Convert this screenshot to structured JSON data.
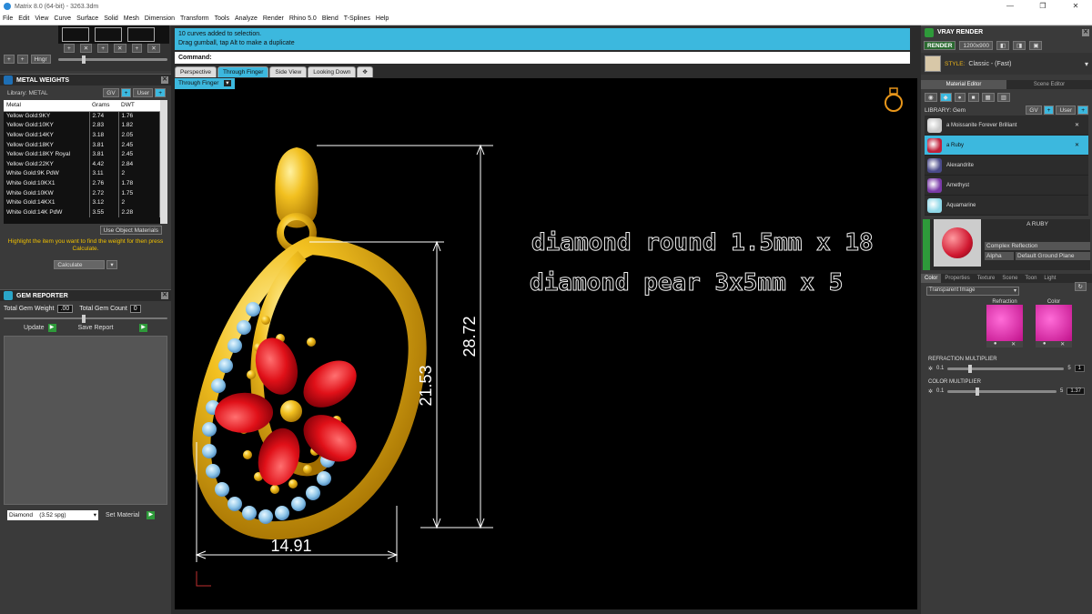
{
  "window": {
    "title": "Matrix 8.0 (64-bit) - 3263.3dm",
    "controls": [
      "—",
      "❐",
      "✕"
    ]
  },
  "menu": [
    "File",
    "Edit",
    "View",
    "Curve",
    "Surface",
    "Solid",
    "Mesh",
    "Dimension",
    "Transform",
    "Tools",
    "Analyze",
    "Render",
    "Rhino 5.0",
    "Blend",
    "T-Splines",
    "Help"
  ],
  "left_toolbar": {
    "hinge_label": "Hngr"
  },
  "metal_weights": {
    "title": "METAL WEIGHTS",
    "library_label": "Library: METAL",
    "gv_label": "GV",
    "user_label": "User",
    "columns": [
      "Metal",
      "Grams",
      "DWT"
    ],
    "rows": [
      [
        "Yellow Gold:9KY",
        "2.74",
        "1.76"
      ],
      [
        "Yellow Gold:10KY",
        "2.83",
        "1.82"
      ],
      [
        "Yellow Gold:14KY",
        "3.18",
        "2.05"
      ],
      [
        "Yellow Gold:18KY",
        "3.81",
        "2.45"
      ],
      [
        "Yellow Gold:18KY Royal",
        "3.81",
        "2.45"
      ],
      [
        "Yellow Gold:22KY",
        "4.42",
        "2.84"
      ],
      [
        "White Gold:9K PdW",
        "3.11",
        "2"
      ],
      [
        "White Gold:10KX1",
        "2.76",
        "1.78"
      ],
      [
        "White Gold:10KW",
        "2.72",
        "1.75"
      ],
      [
        "White Gold:14KX1",
        "3.12",
        "2"
      ],
      [
        "White Gold:14K PdW",
        "3.55",
        "2.28"
      ]
    ],
    "use_object_materials": "Use Object Materials",
    "hint": "Highlight the item you want to find the weight for then press Calculate.",
    "calculate": "Calculate"
  },
  "gem_reporter": {
    "title": "GEM REPORTER",
    "total_weight_label": "Total Gem Weight",
    "total_weight_value": ".00",
    "total_count_label": "Total Gem Count",
    "total_count_value": "0",
    "update": "Update",
    "save_report": "Save Report",
    "gem_select": "Diamond    (3.52 spg)",
    "set_material": "Set Material"
  },
  "command": {
    "history_line1": "10 curves added to selection.",
    "history_line2": "Drag gumball, tap Alt to make a duplicate",
    "prompt": "Command:"
  },
  "viewport_tabs": [
    "Perspective",
    "Through Finger",
    "Side View",
    "Looking Down",
    "✥"
  ],
  "active_viewport": "Through Finger",
  "viewport": {
    "text1": "diamond round  1.5mm x 18",
    "text2": "diamond pear 3x5mm x 5",
    "dim_width": "14.91",
    "dim_inner": "21.53",
    "dim_total": "28.72"
  },
  "vray": {
    "title": "VRAY RENDER",
    "render_btn": "RENDER",
    "resolution": "1200x900",
    "style_label": "STYLE:",
    "style_value": "Classic - (Fast)",
    "tabs": [
      "Material Editor",
      "Scene Editor"
    ],
    "library_label": "LIBRARY: Gem",
    "gv_label": "GV",
    "user_label": "User",
    "materials": [
      {
        "name": "a Moissanite Forever Brilliant",
        "color": "#c8c8c8"
      },
      {
        "name": "a Ruby",
        "color": "#c0203a"
      },
      {
        "name": "Alexandrite",
        "color": "#4a4a8a"
      },
      {
        "name": "Amethyst",
        "color": "#7a3aa8"
      },
      {
        "name": "Aquamarine",
        "color": "#8fd8e8"
      }
    ],
    "selected_material": "A RUBY",
    "complex_reflection": "Complex Reflection",
    "alpha_label": "Alpha",
    "ground_plane": "Default Ground Plane",
    "prop_tabs": [
      "Color",
      "Properties",
      "Texture",
      "Scene",
      "Toon",
      "Light"
    ],
    "transparent_image": "Transparent Image",
    "swatch_refraction": "Refraction",
    "swatch_color": "Color",
    "refraction_mult_label": "REFRACTION MULTIPLIER",
    "refraction_min": "0.1",
    "refraction_max": "5",
    "refraction_value": "1",
    "refraction_level": 0.18,
    "color_mult_label": "COLOR MULTIPLIER",
    "color_min": "0.1",
    "color_max": "5",
    "color_value": "1.37",
    "color_level": 0.26
  },
  "colors": {
    "accent": "#3cb8de",
    "gold": "#e8b21a",
    "ruby": "#e0202a",
    "aqua": "#8fc8e8"
  }
}
